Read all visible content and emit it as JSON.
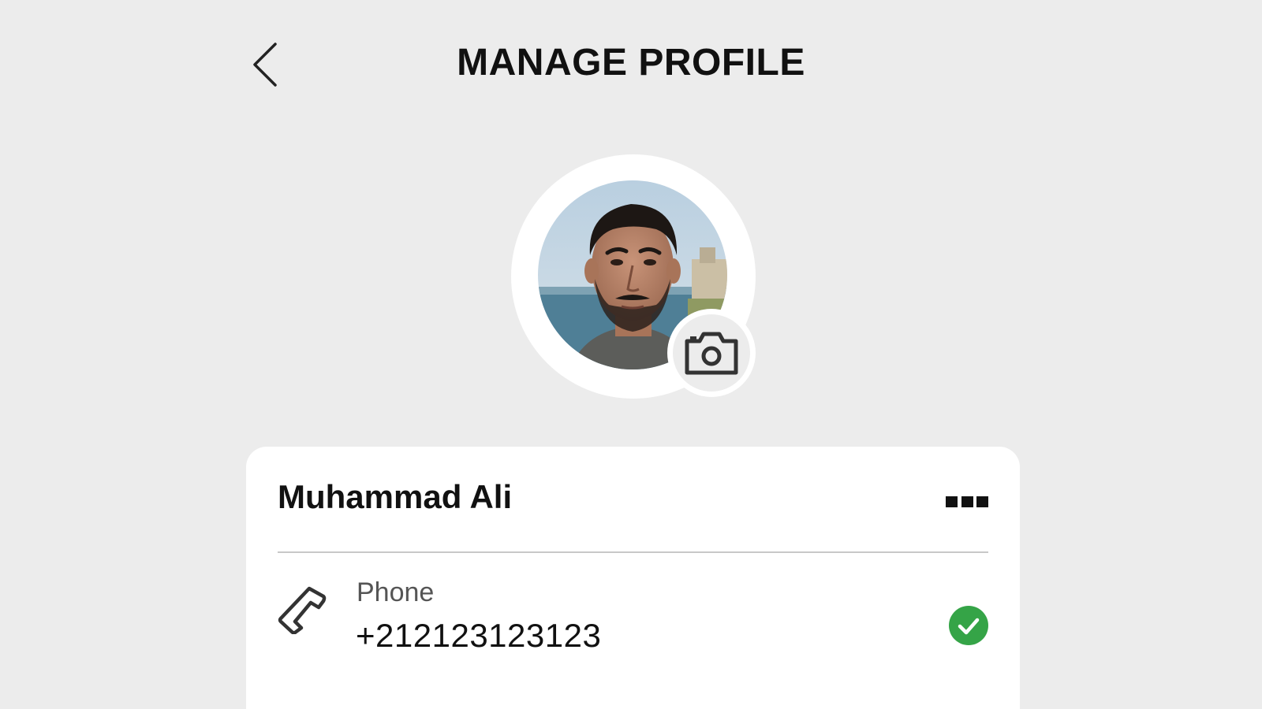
{
  "header": {
    "title": "MANAGE PROFILE",
    "back_icon": "chevron-left-icon"
  },
  "avatar": {
    "camera_icon": "camera-icon"
  },
  "profile": {
    "name": "Muhammad Ali",
    "more_icon": "more-icon"
  },
  "contact": {
    "phone_label": "Phone",
    "phone_value": "+21212312312​3",
    "phone_icon": "phone-icon",
    "verified_icon": "check-circle-icon"
  },
  "colors": {
    "background": "#ececec",
    "card": "#ffffff",
    "verified": "#35a447"
  }
}
